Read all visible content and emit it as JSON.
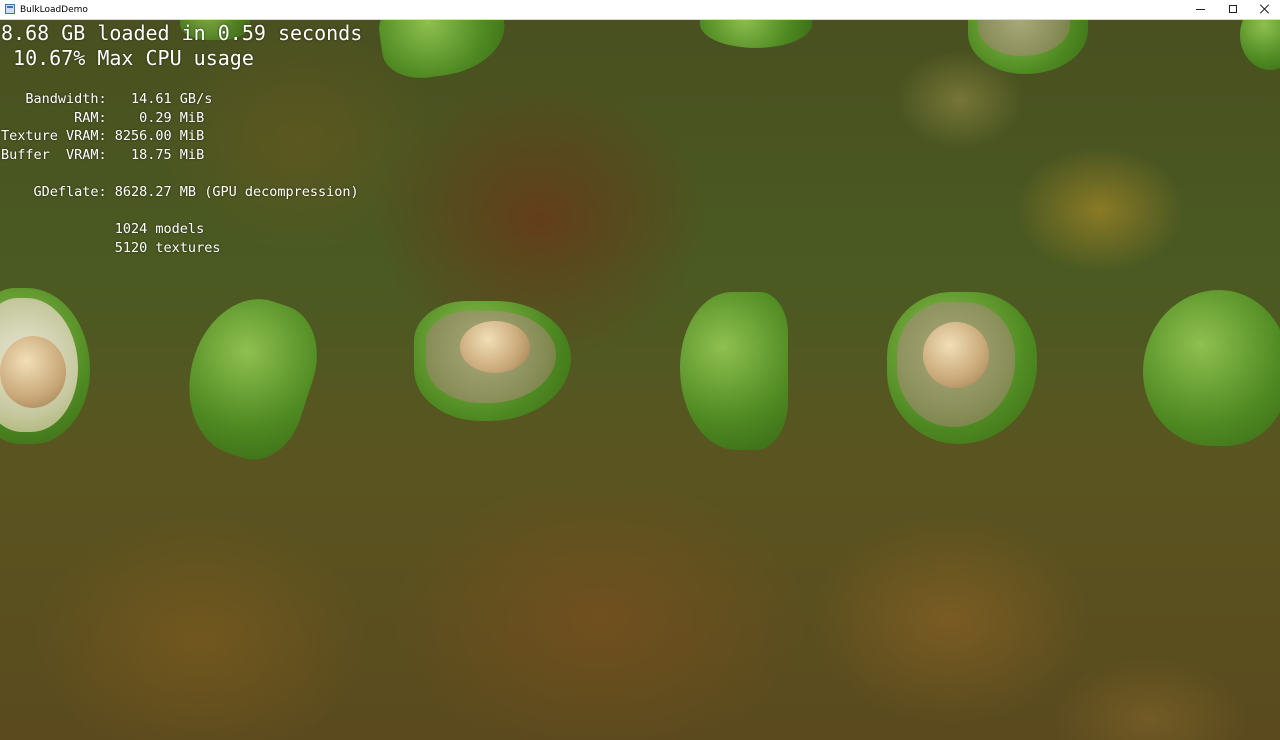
{
  "window": {
    "title": "BulkLoadDemo"
  },
  "hud": {
    "loaded": "8.68 GB loaded in 0.59 seconds",
    "cpu": " 10.67% Max CPU usage",
    "bandwidth": "   Bandwidth:   14.61 GB/s",
    "ram": "         RAM:    0.29 MiB",
    "texture_vram": "Texture VRAM: 8256.00 MiB",
    "buffer_vram": "Buffer  VRAM:   18.75 MiB",
    "gdeflate": "    GDeflate: 8628.27 MB (GPU decompression)",
    "models": "              1024 models",
    "textures": "              5120 textures"
  }
}
